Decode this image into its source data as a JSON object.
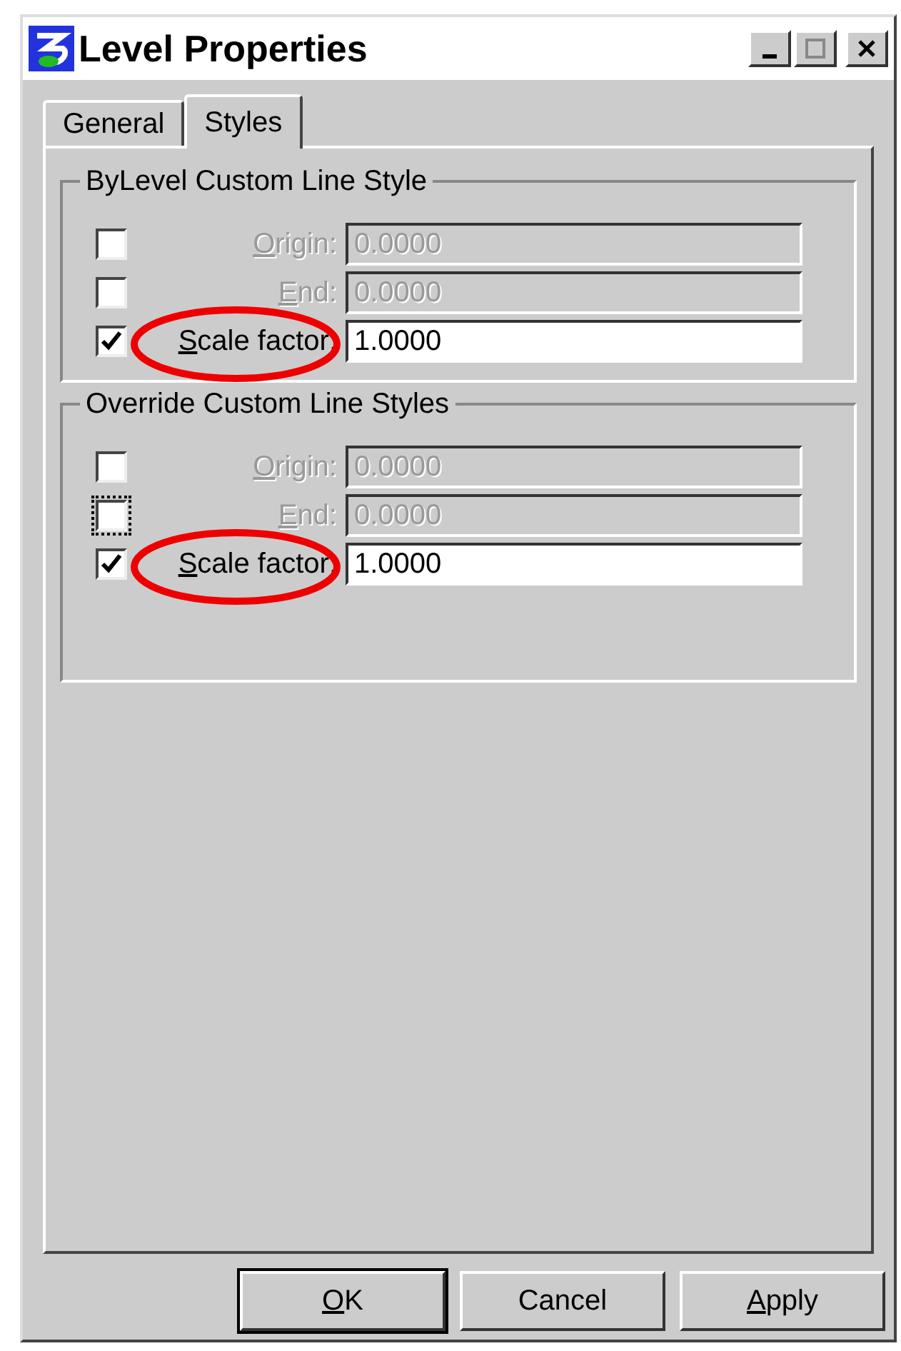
{
  "window": {
    "title": "Level Properties"
  },
  "tabs": [
    {
      "label": "General",
      "selected": false
    },
    {
      "label": "Styles",
      "selected": true
    }
  ],
  "groups": [
    {
      "title": "ByLevel Custom Line Style",
      "rows": [
        {
          "label": "Origin:",
          "value": "0.0000",
          "checked": false,
          "disabled": true,
          "focused": false,
          "highlighted": false,
          "access_key_first": true
        },
        {
          "label": "End:",
          "value": "0.0000",
          "checked": false,
          "disabled": true,
          "focused": false,
          "highlighted": false,
          "access_key_first": true
        },
        {
          "label": "Scale factor:",
          "value": "1.0000",
          "checked": true,
          "disabled": false,
          "focused": false,
          "highlighted": true,
          "access_key_first": true
        }
      ]
    },
    {
      "title": "Override Custom Line Styles",
      "rows": [
        {
          "label": "Origin:",
          "value": "0.0000",
          "checked": false,
          "disabled": true,
          "focused": false,
          "highlighted": false,
          "access_key_first": true
        },
        {
          "label": "End:",
          "value": "0.0000",
          "checked": false,
          "disabled": true,
          "focused": true,
          "highlighted": false,
          "access_key_first": true
        },
        {
          "label": "Scale factor:",
          "value": "1.0000",
          "checked": true,
          "disabled": false,
          "focused": false,
          "highlighted": true,
          "access_key_first": true
        }
      ]
    }
  ],
  "buttons": [
    {
      "label": "OK",
      "default": true,
      "access_key_first": true
    },
    {
      "label": "Cancel",
      "default": false,
      "access_key_first": false
    },
    {
      "label": "Apply",
      "default": false,
      "access_key_first": true
    }
  ]
}
